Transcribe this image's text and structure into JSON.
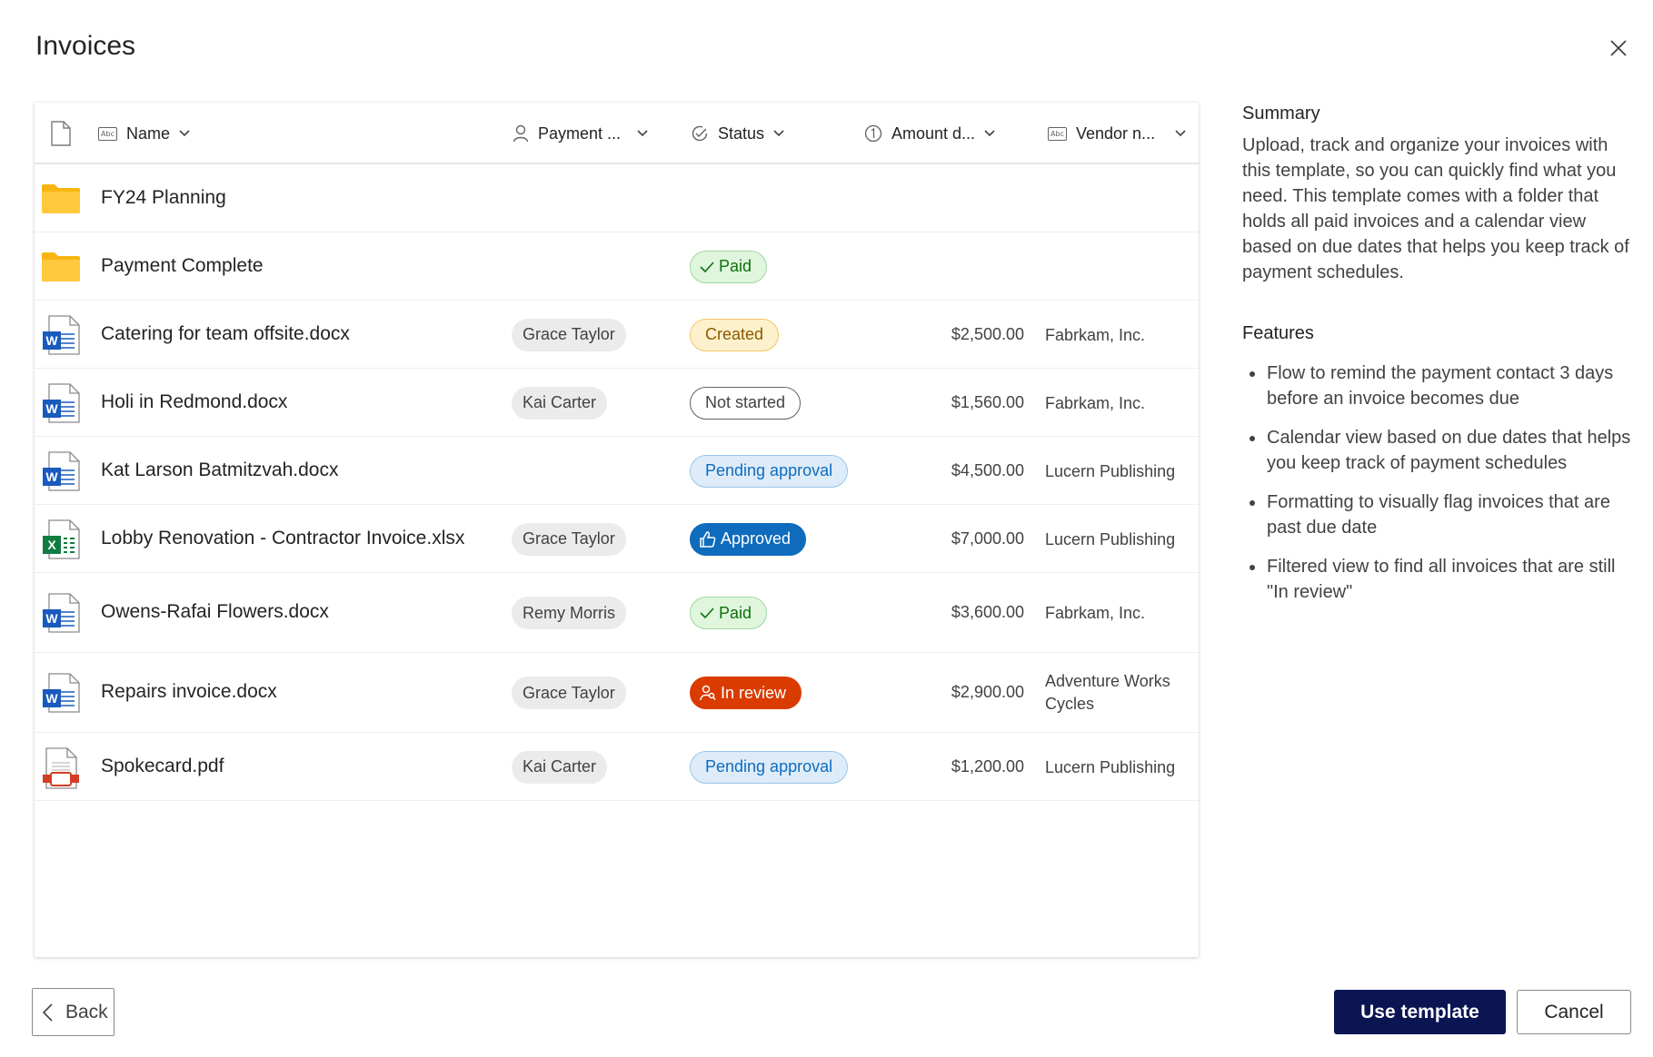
{
  "dialog": {
    "title": "Invoices",
    "close_icon": "close-icon"
  },
  "table": {
    "columns": [
      {
        "label": "Name",
        "icon": "text-field-icon"
      },
      {
        "label": "Payment ...",
        "icon": "person-icon"
      },
      {
        "label": "Status",
        "icon": "check-circle-icon"
      },
      {
        "label": "Amount d...",
        "icon": "number-icon"
      },
      {
        "label": "Vendor n...",
        "icon": "text-field-icon"
      }
    ],
    "rows": [
      {
        "type": "folder",
        "name": "FY24 Planning",
        "person": "",
        "status": "",
        "amount": "",
        "vendor": ""
      },
      {
        "type": "folder",
        "name": "Payment Complete",
        "person": "",
        "status": "Paid",
        "amount": "",
        "vendor": ""
      },
      {
        "type": "word",
        "name": "Catering for team offsite.docx",
        "person": "Grace Taylor",
        "status": "Created",
        "amount": "$2,500.00",
        "vendor": "Fabrkam, Inc."
      },
      {
        "type": "word",
        "name": "Holi in Redmond.docx",
        "person": "Kai Carter",
        "status": "Not started",
        "amount": "$1,560.00",
        "vendor": "Fabrkam, Inc."
      },
      {
        "type": "word",
        "name": "Kat Larson Batmitzvah.docx",
        "person": "",
        "status": "Pending approval",
        "amount": "$4,500.00",
        "vendor": "Lucern Publishing"
      },
      {
        "type": "excel",
        "name": "Lobby Renovation - Contractor Invoice.xlsx",
        "person": "Grace Taylor",
        "status": "Approved",
        "amount": "$7,000.00",
        "vendor": "Lucern Publishing"
      },
      {
        "type": "word",
        "name": "Owens-Rafai Flowers.docx",
        "person": "Remy Morris",
        "status": "Paid",
        "amount": "$3,600.00",
        "vendor": "Fabrkam, Inc."
      },
      {
        "type": "word",
        "name": "Repairs invoice.docx",
        "person": "Grace Taylor",
        "status": "In review",
        "amount": "$2,900.00",
        "vendor": "Adventure Works Cycles"
      },
      {
        "type": "pdf",
        "name": "Spokecard.pdf",
        "person": "Kai Carter",
        "status": "Pending approval",
        "amount": "$1,200.00",
        "vendor": "Lucern Publishing"
      }
    ]
  },
  "summary": {
    "heading": "Summary",
    "text": "Upload, track and organize your invoices with this template, so you can quickly find what you need. This template comes with a folder that holds all paid invoices and a calendar view based on due dates that helps you keep track of payment schedules.",
    "features_heading": "Features",
    "features": [
      "Flow to remind the payment contact 3 days before an invoice becomes due",
      "Calendar view based on due dates that helps you keep track of payment schedules",
      "Formatting to visually flag invoices that are past due date",
      "Filtered view to find all invoices that are still \"In review\""
    ]
  },
  "footer": {
    "back_label": "Back",
    "use_label": "Use template",
    "cancel_label": "Cancel"
  },
  "colors": {
    "primary": "#0b1552",
    "approved": "#0f6cbd",
    "in_review": "#da3b01",
    "folder": "#f8b512",
    "word": "#185abd",
    "excel": "#107c41",
    "pdf": "#d33c25"
  }
}
